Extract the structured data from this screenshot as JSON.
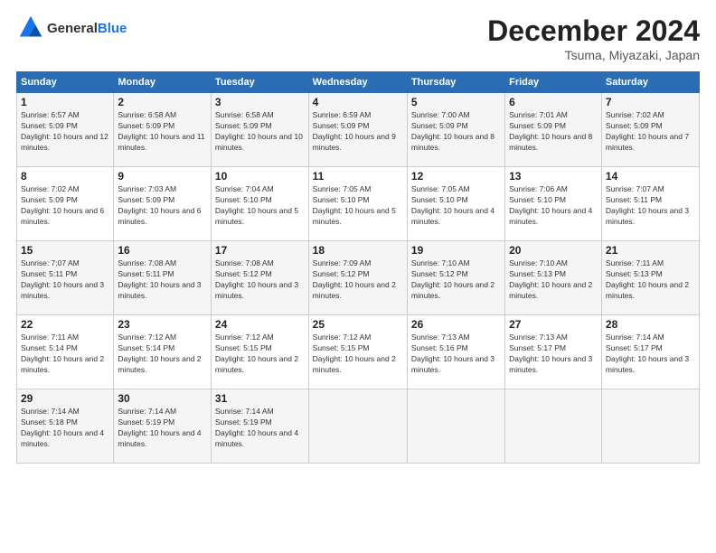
{
  "logo": {
    "general": "General",
    "blue": "Blue"
  },
  "header": {
    "month": "December 2024",
    "location": "Tsuma, Miyazaki, Japan"
  },
  "weekdays": [
    "Sunday",
    "Monday",
    "Tuesday",
    "Wednesday",
    "Thursday",
    "Friday",
    "Saturday"
  ],
  "weeks": [
    [
      {
        "day": "1",
        "sunrise": "Sunrise: 6:57 AM",
        "sunset": "Sunset: 5:09 PM",
        "daylight": "Daylight: 10 hours and 12 minutes."
      },
      {
        "day": "2",
        "sunrise": "Sunrise: 6:58 AM",
        "sunset": "Sunset: 5:09 PM",
        "daylight": "Daylight: 10 hours and 11 minutes."
      },
      {
        "day": "3",
        "sunrise": "Sunrise: 6:58 AM",
        "sunset": "Sunset: 5:09 PM",
        "daylight": "Daylight: 10 hours and 10 minutes."
      },
      {
        "day": "4",
        "sunrise": "Sunrise: 6:59 AM",
        "sunset": "Sunset: 5:09 PM",
        "daylight": "Daylight: 10 hours and 9 minutes."
      },
      {
        "day": "5",
        "sunrise": "Sunrise: 7:00 AM",
        "sunset": "Sunset: 5:09 PM",
        "daylight": "Daylight: 10 hours and 8 minutes."
      },
      {
        "day": "6",
        "sunrise": "Sunrise: 7:01 AM",
        "sunset": "Sunset: 5:09 PM",
        "daylight": "Daylight: 10 hours and 8 minutes."
      },
      {
        "day": "7",
        "sunrise": "Sunrise: 7:02 AM",
        "sunset": "Sunset: 5:09 PM",
        "daylight": "Daylight: 10 hours and 7 minutes."
      }
    ],
    [
      {
        "day": "8",
        "sunrise": "Sunrise: 7:02 AM",
        "sunset": "Sunset: 5:09 PM",
        "daylight": "Daylight: 10 hours and 6 minutes."
      },
      {
        "day": "9",
        "sunrise": "Sunrise: 7:03 AM",
        "sunset": "Sunset: 5:09 PM",
        "daylight": "Daylight: 10 hours and 6 minutes."
      },
      {
        "day": "10",
        "sunrise": "Sunrise: 7:04 AM",
        "sunset": "Sunset: 5:10 PM",
        "daylight": "Daylight: 10 hours and 5 minutes."
      },
      {
        "day": "11",
        "sunrise": "Sunrise: 7:05 AM",
        "sunset": "Sunset: 5:10 PM",
        "daylight": "Daylight: 10 hours and 5 minutes."
      },
      {
        "day": "12",
        "sunrise": "Sunrise: 7:05 AM",
        "sunset": "Sunset: 5:10 PM",
        "daylight": "Daylight: 10 hours and 4 minutes."
      },
      {
        "day": "13",
        "sunrise": "Sunrise: 7:06 AM",
        "sunset": "Sunset: 5:10 PM",
        "daylight": "Daylight: 10 hours and 4 minutes."
      },
      {
        "day": "14",
        "sunrise": "Sunrise: 7:07 AM",
        "sunset": "Sunset: 5:11 PM",
        "daylight": "Daylight: 10 hours and 3 minutes."
      }
    ],
    [
      {
        "day": "15",
        "sunrise": "Sunrise: 7:07 AM",
        "sunset": "Sunset: 5:11 PM",
        "daylight": "Daylight: 10 hours and 3 minutes."
      },
      {
        "day": "16",
        "sunrise": "Sunrise: 7:08 AM",
        "sunset": "Sunset: 5:11 PM",
        "daylight": "Daylight: 10 hours and 3 minutes."
      },
      {
        "day": "17",
        "sunrise": "Sunrise: 7:08 AM",
        "sunset": "Sunset: 5:12 PM",
        "daylight": "Daylight: 10 hours and 3 minutes."
      },
      {
        "day": "18",
        "sunrise": "Sunrise: 7:09 AM",
        "sunset": "Sunset: 5:12 PM",
        "daylight": "Daylight: 10 hours and 2 minutes."
      },
      {
        "day": "19",
        "sunrise": "Sunrise: 7:10 AM",
        "sunset": "Sunset: 5:12 PM",
        "daylight": "Daylight: 10 hours and 2 minutes."
      },
      {
        "day": "20",
        "sunrise": "Sunrise: 7:10 AM",
        "sunset": "Sunset: 5:13 PM",
        "daylight": "Daylight: 10 hours and 2 minutes."
      },
      {
        "day": "21",
        "sunrise": "Sunrise: 7:11 AM",
        "sunset": "Sunset: 5:13 PM",
        "daylight": "Daylight: 10 hours and 2 minutes."
      }
    ],
    [
      {
        "day": "22",
        "sunrise": "Sunrise: 7:11 AM",
        "sunset": "Sunset: 5:14 PM",
        "daylight": "Daylight: 10 hours and 2 minutes."
      },
      {
        "day": "23",
        "sunrise": "Sunrise: 7:12 AM",
        "sunset": "Sunset: 5:14 PM",
        "daylight": "Daylight: 10 hours and 2 minutes."
      },
      {
        "day": "24",
        "sunrise": "Sunrise: 7:12 AM",
        "sunset": "Sunset: 5:15 PM",
        "daylight": "Daylight: 10 hours and 2 minutes."
      },
      {
        "day": "25",
        "sunrise": "Sunrise: 7:12 AM",
        "sunset": "Sunset: 5:15 PM",
        "daylight": "Daylight: 10 hours and 2 minutes."
      },
      {
        "day": "26",
        "sunrise": "Sunrise: 7:13 AM",
        "sunset": "Sunset: 5:16 PM",
        "daylight": "Daylight: 10 hours and 3 minutes."
      },
      {
        "day": "27",
        "sunrise": "Sunrise: 7:13 AM",
        "sunset": "Sunset: 5:17 PM",
        "daylight": "Daylight: 10 hours and 3 minutes."
      },
      {
        "day": "28",
        "sunrise": "Sunrise: 7:14 AM",
        "sunset": "Sunset: 5:17 PM",
        "daylight": "Daylight: 10 hours and 3 minutes."
      }
    ],
    [
      {
        "day": "29",
        "sunrise": "Sunrise: 7:14 AM",
        "sunset": "Sunset: 5:18 PM",
        "daylight": "Daylight: 10 hours and 4 minutes."
      },
      {
        "day": "30",
        "sunrise": "Sunrise: 7:14 AM",
        "sunset": "Sunset: 5:19 PM",
        "daylight": "Daylight: 10 hours and 4 minutes."
      },
      {
        "day": "31",
        "sunrise": "Sunrise: 7:14 AM",
        "sunset": "Sunset: 5:19 PM",
        "daylight": "Daylight: 10 hours and 4 minutes."
      },
      null,
      null,
      null,
      null
    ]
  ]
}
